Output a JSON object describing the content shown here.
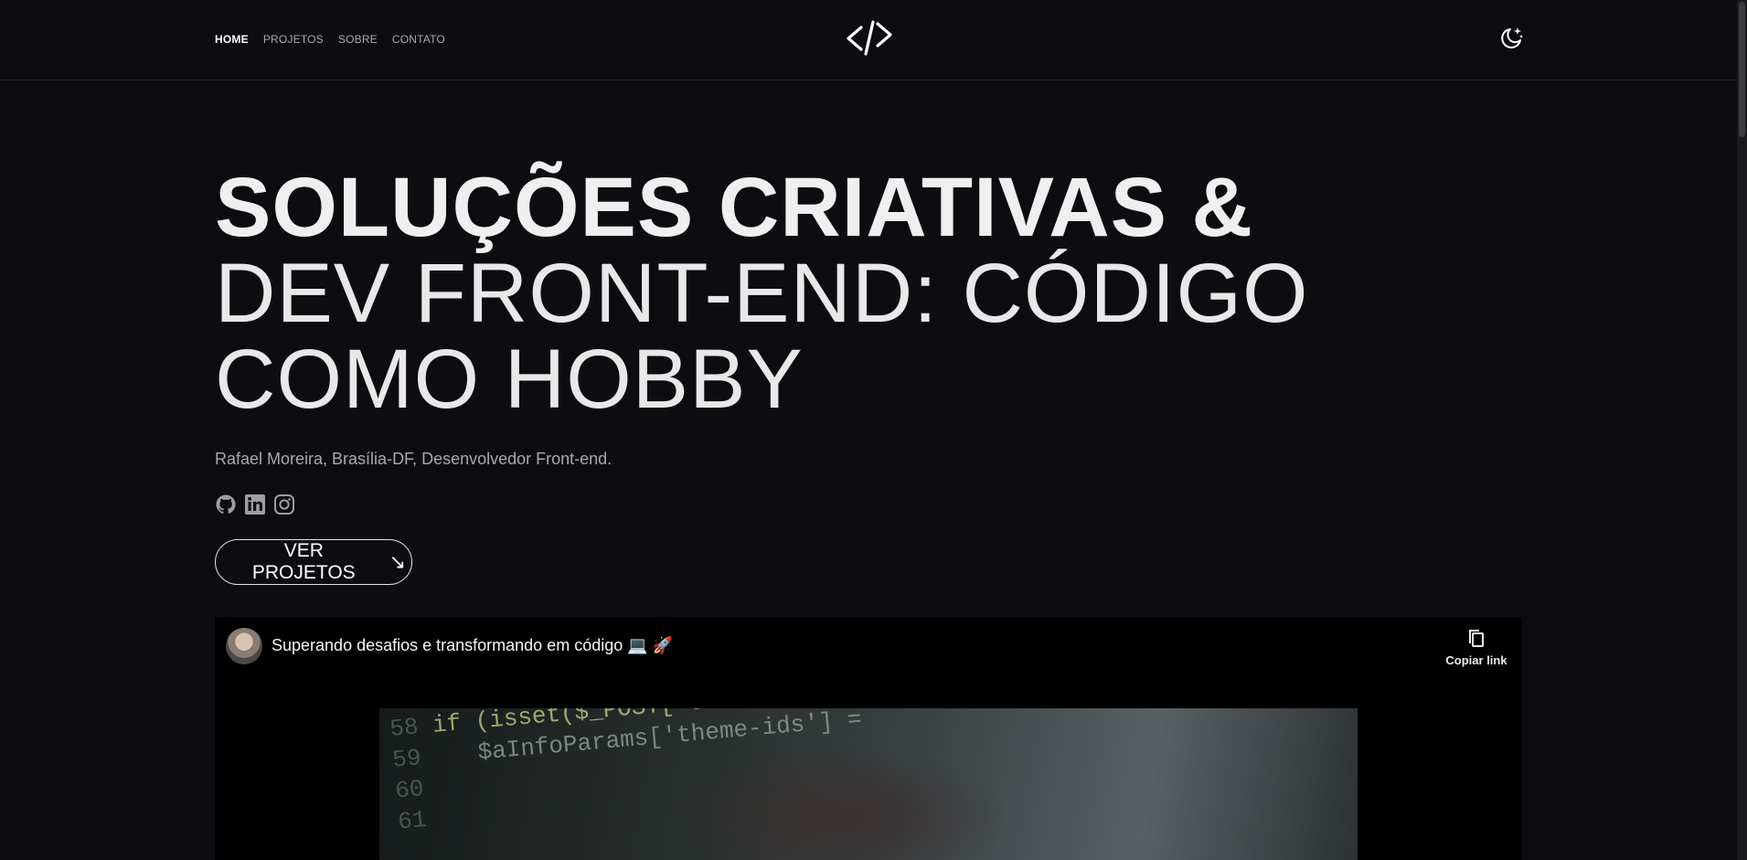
{
  "nav": {
    "items": [
      {
        "label": "HOME",
        "active": true
      },
      {
        "label": "PROJETOS",
        "active": false
      },
      {
        "label": "SOBRE",
        "active": false
      },
      {
        "label": "CONTATO",
        "active": false
      }
    ],
    "logo_icon": "code-brackets-icon",
    "theme_icon": "moon-stars-icon"
  },
  "hero": {
    "title_bold": "SOLUÇÕES CRIATIVAS &",
    "title_light": "DEV FRONT-END: CÓDIGO COMO HOBBY",
    "subtitle": "Rafael Moreira, Brasília-DF, Desenvolvedor Front-end.",
    "socials": [
      "github-icon",
      "linkedin-icon",
      "instagram-icon"
    ],
    "cta_label": "VER PROJETOS",
    "cta_arrow": "↘"
  },
  "video": {
    "title": "Superando desafios e transformando em código 💻 🚀",
    "copy_label": "Copiar link",
    "thumbnail_code": {
      "line_numbers": [
        "58",
        "59",
        "60",
        "61"
      ],
      "lines": [
        "if (isset($_POST['theme",
        "   $aInfoParams['theme-ids'] ="
      ]
    }
  },
  "colors": {
    "background": "#0d0c11",
    "text": "#f2f2f2",
    "muted": "#a8a8ad",
    "divider": "#26252b"
  }
}
